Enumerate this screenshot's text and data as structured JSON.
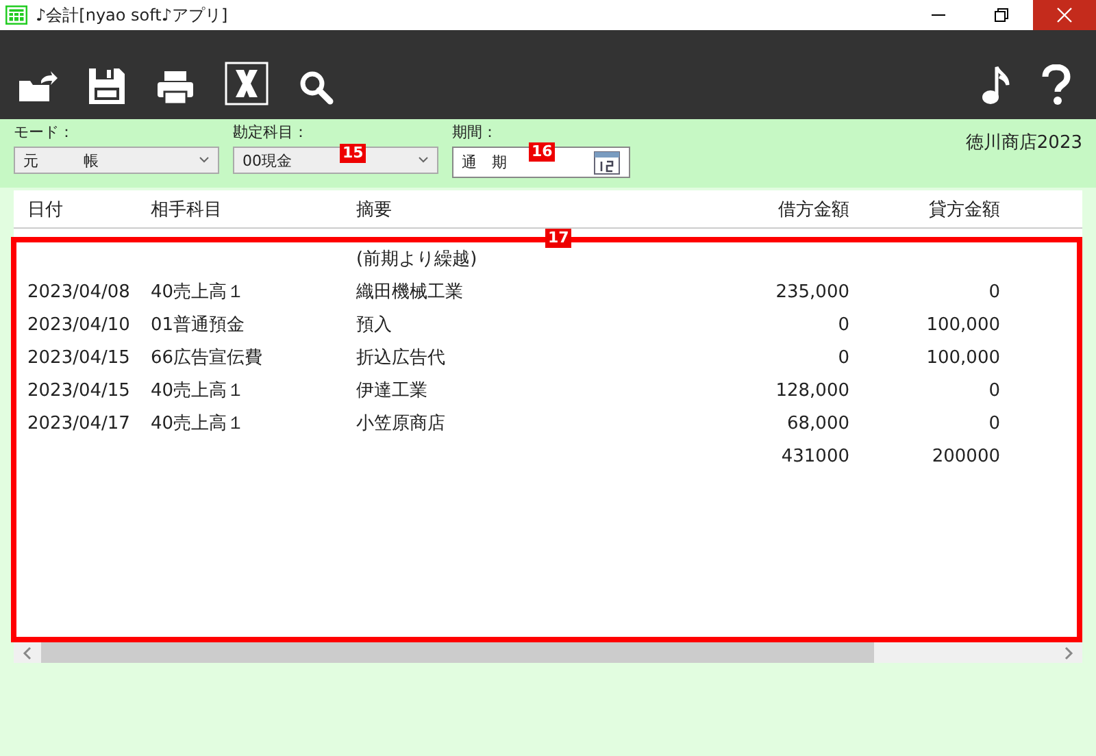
{
  "window": {
    "title": "♪会計[nyao soft♪アプリ]"
  },
  "filters": [
    {
      "kind": "select",
      "label": "モード：",
      "value": "元　　　帳"
    },
    {
      "kind": "select",
      "label": "勘定科目：",
      "value": "00現金",
      "callout": "15"
    },
    {
      "kind": "date",
      "label": "期間：",
      "value": "通　期",
      "callout": "16"
    }
  ],
  "company": "徳川商店2023",
  "table": {
    "callout": "17",
    "columns": [
      "日付",
      "相手科目",
      "摘要",
      "借方金額",
      "貸方金額"
    ],
    "rows": [
      {
        "summary": "(前期より繰越)"
      },
      {
        "date": "2023/04/08",
        "partner": "40売上高１",
        "summary": "織田機械工業",
        "debit": "235,000",
        "credit": "0"
      },
      {
        "date": "2023/04/10",
        "partner": "01普通預金",
        "summary": "預入",
        "debit": "0",
        "credit": "100,000"
      },
      {
        "date": "2023/04/15",
        "partner": "66広告宣伝費",
        "summary": "折込広告代",
        "debit": "0",
        "credit": "100,000"
      },
      {
        "date": "2023/04/15",
        "partner": "40売上高１",
        "summary": "伊達工業",
        "debit": "128,000",
        "credit": "0"
      },
      {
        "date": "2023/04/17",
        "partner": "40売上高１",
        "summary": "小笠原商店",
        "debit": "68,000",
        "credit": "0"
      },
      {
        "debit": "431000",
        "credit": "200000"
      }
    ]
  }
}
